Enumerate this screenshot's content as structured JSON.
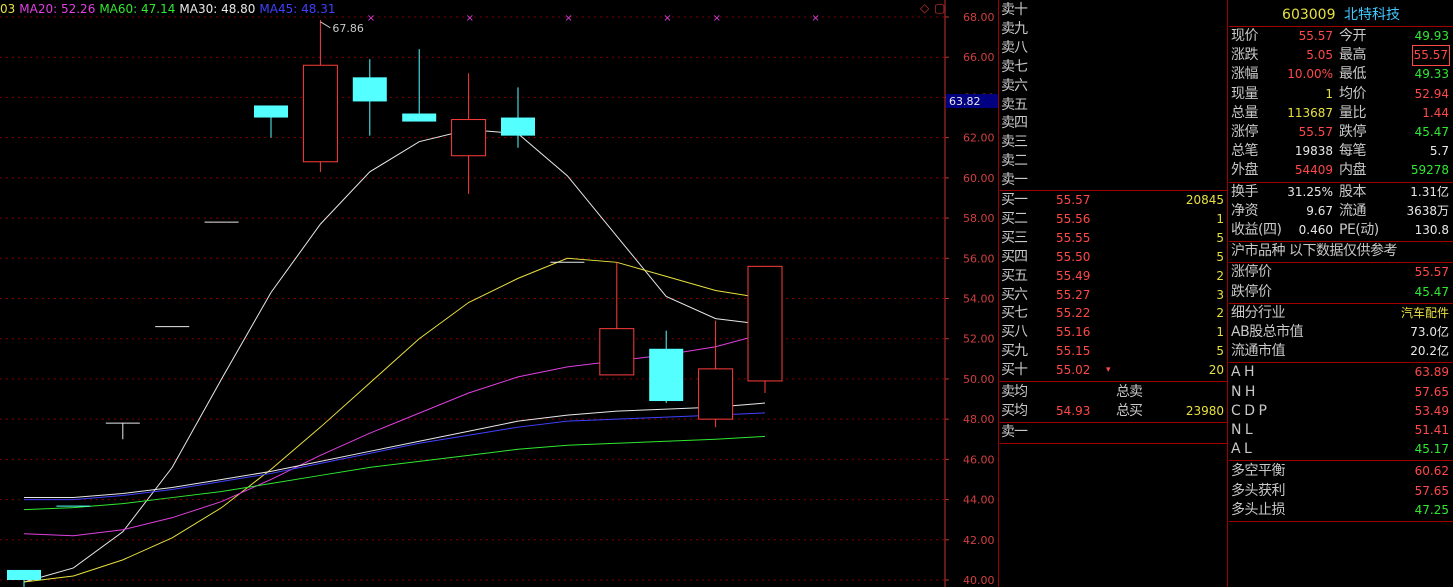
{
  "legend": [
    {
      "text": "03",
      "color": "#e8e040"
    },
    {
      "text": "MA20: 52.26",
      "color": "#e040e0"
    },
    {
      "text": "MA60: 47.14",
      "color": "#30e830"
    },
    {
      "text": "MA30: 48.80",
      "color": "#e8e8e8"
    },
    {
      "text": "MA45: 48.31",
      "color": "#4040ff"
    }
  ],
  "corner_icons": [
    "◇",
    "▢"
  ],
  "chart_data": {
    "type": "candlestick",
    "ylim": [
      40,
      68
    ],
    "y_ticks": [
      "68.00",
      "66.00",
      "64.00",
      "62.00",
      "60.00",
      "58.00",
      "56.00",
      "54.00",
      "52.00",
      "50.00",
      "48.00",
      "46.00",
      "44.00",
      "42.00",
      "40.00"
    ],
    "current_price_label": "63.82",
    "current_price": 63.82,
    "high_annotation": "67.86",
    "high_value": 67.86,
    "candles": [
      {
        "open": 40.0,
        "close": 40.5,
        "high": 40.5,
        "low": 39.6,
        "color": "cyan"
      },
      {
        "open": 43.7,
        "close": 43.7,
        "high": 43.7,
        "low": 43.7,
        "color": "cyan"
      },
      {
        "open": 47.8,
        "close": 47.8,
        "high": 47.8,
        "low": 47.0,
        "color": "white"
      },
      {
        "open": 52.6,
        "close": 52.6,
        "high": 52.6,
        "low": 52.6,
        "color": "white"
      },
      {
        "open": 57.8,
        "close": 57.8,
        "high": 57.8,
        "low": 57.8,
        "color": "white"
      },
      {
        "open": 63.6,
        "close": 63.0,
        "high": 63.6,
        "low": 62.0,
        "color": "cyan"
      },
      {
        "open": 60.8,
        "close": 65.6,
        "high": 67.86,
        "low": 60.3,
        "color": "red"
      },
      {
        "open": 65.0,
        "close": 63.8,
        "high": 65.9,
        "low": 62.1,
        "color": "cyan"
      },
      {
        "open": 63.2,
        "close": 62.8,
        "high": 66.4,
        "low": 62.8,
        "color": "cyan"
      },
      {
        "open": 61.1,
        "close": 62.9,
        "high": 65.2,
        "low": 59.2,
        "color": "red"
      },
      {
        "open": 63.0,
        "close": 62.1,
        "high": 64.5,
        "low": 61.5,
        "color": "cyan"
      },
      {
        "open": 55.8,
        "close": 55.8,
        "high": 55.8,
        "low": 55.8,
        "color": "white"
      },
      {
        "open": 50.2,
        "close": 52.5,
        "high": 55.8,
        "low": 50.2,
        "color": "red"
      },
      {
        "open": 51.5,
        "close": 48.9,
        "high": 52.4,
        "low": 48.8,
        "color": "cyan"
      },
      {
        "open": 48.0,
        "close": 50.5,
        "high": 52.9,
        "low": 47.6,
        "color": "red"
      },
      {
        "open": 49.9,
        "close": 55.6,
        "high": 55.6,
        "low": 49.3,
        "color": "red"
      }
    ],
    "ma_series": [
      {
        "color": "#e8e8e8",
        "values": [
          39.9,
          40.6,
          42.4,
          45.6,
          50.0,
          54.3,
          57.7,
          60.3,
          61.8,
          62.4,
          62.2,
          60.1,
          57.1,
          54.1,
          53.0,
          52.7
        ]
      },
      {
        "color": "#e8e040",
        "values": [
          39.9,
          40.2,
          41.0,
          42.1,
          43.6,
          45.5,
          47.6,
          49.8,
          52.0,
          53.8,
          55.0,
          56.0,
          55.8,
          55.1,
          54.4,
          54.0
        ]
      },
      {
        "color": "#e040e0",
        "values": [
          42.3,
          42.2,
          42.5,
          43.1,
          43.9,
          45.0,
          46.2,
          47.3,
          48.3,
          49.3,
          50.1,
          50.6,
          50.9,
          51.2,
          51.6,
          52.26
        ]
      },
      {
        "color": "#e8e8e8",
        "values": [
          44.1,
          44.1,
          44.3,
          44.6,
          45.0,
          45.4,
          45.9,
          46.4,
          46.9,
          47.4,
          47.9,
          48.2,
          48.4,
          48.5,
          48.6,
          48.8
        ]
      },
      {
        "color": "#4040ff",
        "values": [
          44.0,
          44.0,
          44.2,
          44.5,
          44.9,
          45.3,
          45.8,
          46.3,
          46.8,
          47.2,
          47.6,
          47.9,
          48.0,
          48.1,
          48.2,
          48.31
        ]
      },
      {
        "color": "#30e830",
        "values": [
          43.5,
          43.6,
          43.8,
          44.1,
          44.4,
          44.8,
          45.2,
          45.6,
          45.9,
          46.2,
          46.5,
          46.7,
          46.8,
          46.9,
          47.0,
          47.14
        ]
      }
    ]
  },
  "order_book": {
    "asks": [
      {
        "label": "卖十"
      },
      {
        "label": "卖九"
      },
      {
        "label": "卖八"
      },
      {
        "label": "卖七"
      },
      {
        "label": "卖六"
      },
      {
        "label": "卖五"
      },
      {
        "label": "卖四"
      },
      {
        "label": "卖三"
      },
      {
        "label": "卖二"
      },
      {
        "label": "卖一"
      }
    ],
    "bids": [
      {
        "label": "买一",
        "price": "55.57",
        "vol": "20845"
      },
      {
        "label": "买二",
        "price": "55.56",
        "vol": "1"
      },
      {
        "label": "买三",
        "price": "55.55",
        "vol": "5"
      },
      {
        "label": "买四",
        "price": "55.50",
        "vol": "5"
      },
      {
        "label": "买五",
        "price": "55.49",
        "vol": "2"
      },
      {
        "label": "买六",
        "price": "55.27",
        "vol": "3"
      },
      {
        "label": "买七",
        "price": "55.22",
        "vol": "2"
      },
      {
        "label": "买八",
        "price": "55.16",
        "vol": "1"
      },
      {
        "label": "买九",
        "price": "55.15",
        "vol": "5"
      },
      {
        "label": "买十",
        "price": "55.02",
        "vol": "20",
        "marker": "▾"
      }
    ],
    "sell_avg_label": "卖均",
    "sell_total_label": "总卖",
    "buy_avg_label": "买均",
    "buy_avg_price": "54.93",
    "buy_total_label": "总买",
    "buy_total_vol": "23980",
    "sell_one_label": "卖一"
  },
  "quote": {
    "code": "603009",
    "name": "北特科技",
    "rows": [
      {
        "k1": "现价",
        "v1": "55.57",
        "c1": "red",
        "k2": "今开",
        "v2": "49.93",
        "c2": "grn"
      },
      {
        "k1": "涨跌",
        "v1": "5.05",
        "c1": "red",
        "k2": "最高",
        "v2": "55.57",
        "c2": "red",
        "box2": true
      },
      {
        "k1": "涨幅",
        "v1": "10.00%",
        "c1": "red",
        "k2": "最低",
        "v2": "49.33",
        "c2": "grn"
      },
      {
        "k1": "现量",
        "v1": "1",
        "c1": "yel",
        "k2": "均价",
        "v2": "52.94",
        "c2": "red"
      },
      {
        "k1": "总量",
        "v1": "113687",
        "c1": "yel",
        "k2": "量比",
        "v2": "1.44",
        "c2": "red"
      },
      {
        "k1": "涨停",
        "v1": "55.57",
        "c1": "red",
        "k2": "跌停",
        "v2": "45.47",
        "c2": "grn"
      },
      {
        "k1": "总笔",
        "v1": "19838",
        "c1": "wht",
        "k2": "每笔",
        "v2": "5.7",
        "c2": "wht"
      },
      {
        "k1": "外盘",
        "v1": "54409",
        "c1": "red",
        "k2": "内盘",
        "v2": "59278",
        "c2": "grn"
      }
    ],
    "rows2": [
      {
        "k1": "换手",
        "v1": "31.25%",
        "c1": "wht",
        "k2": "股本",
        "v2": "1.31亿",
        "c2": "wht"
      },
      {
        "k1": "净资",
        "v1": "9.67",
        "c1": "wht",
        "k2": "流通",
        "v2": "3638万",
        "c2": "wht"
      },
      {
        "k1": "收益(四)",
        "v1": "0.460",
        "c1": "wht",
        "k2": "PE(动)",
        "v2": "130.8",
        "c2": "wht"
      }
    ],
    "market_note": "沪市品种  以下数据仅供参考",
    "limits": [
      {
        "k": "涨停价",
        "v": "55.57",
        "c": "red"
      },
      {
        "k": "跌停价",
        "v": "45.47",
        "c": "grn"
      }
    ],
    "sector": [
      {
        "k": "细分行业",
        "v": "汽车配件",
        "c": "yel"
      },
      {
        "k": "AB股总市值",
        "v": "73.0亿",
        "c": "wht"
      },
      {
        "k": "流通市值",
        "v": "20.2亿",
        "c": "wht"
      }
    ],
    "indicators": [
      {
        "k": "A H",
        "v": "63.89",
        "c": "red"
      },
      {
        "k": "N H",
        "v": "57.65",
        "c": "red"
      },
      {
        "k": "C D P",
        "v": "53.49",
        "c": "red"
      },
      {
        "k": "N L",
        "v": "51.41",
        "c": "red"
      },
      {
        "k": "A L",
        "v": "45.17",
        "c": "grn"
      }
    ],
    "balance": [
      {
        "k": "多空平衡",
        "v": "60.62",
        "c": "red"
      },
      {
        "k": "多头获利",
        "v": "57.65",
        "c": "red"
      },
      {
        "k": "多头止损",
        "v": "47.25",
        "c": "grn"
      }
    ]
  }
}
